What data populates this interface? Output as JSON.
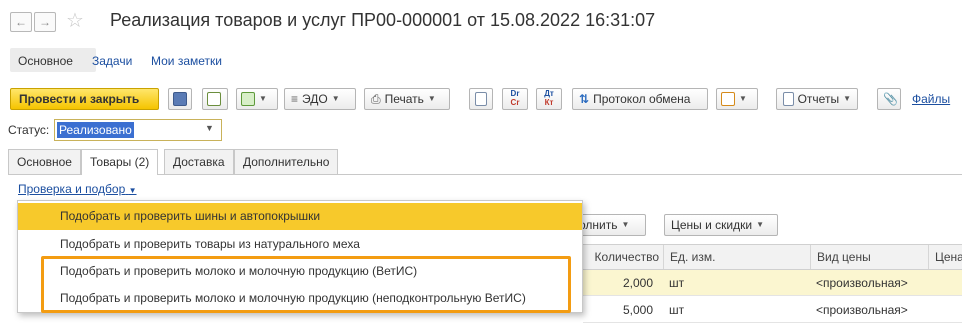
{
  "window": {
    "title": "Реализация товаров и услуг ПР00-000001 от 15.08.2022 16:31:07",
    "back_icon": "arrow-left-icon",
    "forward_icon": "arrow-right-icon",
    "favorite_icon": "star-icon"
  },
  "top_nav": {
    "items": [
      {
        "label": "Основное"
      },
      {
        "label": "Задачи"
      },
      {
        "label": "Мои заметки"
      }
    ]
  },
  "toolbar": {
    "post_close_label": "Провести и закрыть",
    "edo_label": "ЭДО",
    "print_label": "Печать",
    "exchange_protocol_label": "Протокол обмена",
    "reports_label": "Отчеты",
    "files_label": "Файлы",
    "dt_cr_label_top": "Dr",
    "dt_cr_label_bottom": "Cr",
    "dt_kt_label_top": "Дт",
    "dt_kt_label_bottom": "Кт"
  },
  "status": {
    "label": "Статус:",
    "value": "Реализовано"
  },
  "tabs": [
    {
      "label": "Основное"
    },
    {
      "label": "Товары (2)"
    },
    {
      "label": "Доставка"
    },
    {
      "label": "Дополнительно"
    }
  ],
  "check_menu": {
    "trigger_label": "Проверка и подбор",
    "items": [
      {
        "label": "Подобрать и проверить шины и автопокрышки"
      },
      {
        "label": "Подобрать и проверить товары из натурального меха"
      },
      {
        "label": "Подобрать и проверить молоко и молочную продукцию (ВетИС)"
      },
      {
        "label": "Подобрать и проверить молоко и молочную продукцию (неподконтрольную ВетИС)"
      }
    ]
  },
  "table_toolbar": {
    "fill_label": "олнить",
    "prices_label": "Цены и скидки"
  },
  "table": {
    "columns": [
      "Количество",
      "Ед. изм.",
      "Вид цены",
      "Цена"
    ],
    "rows": [
      {
        "qty": "2,000",
        "unit": "шт",
        "price_type": "<произвольная>"
      },
      {
        "qty": "5,000",
        "unit": "шт",
        "price_type": "<произвольная>"
      }
    ]
  },
  "colors": {
    "accent_yellow": "#f7c92b",
    "highlight_orange": "#f39c12",
    "link_blue": "#1c4fa0",
    "selected_row": "#fbf6d0"
  }
}
